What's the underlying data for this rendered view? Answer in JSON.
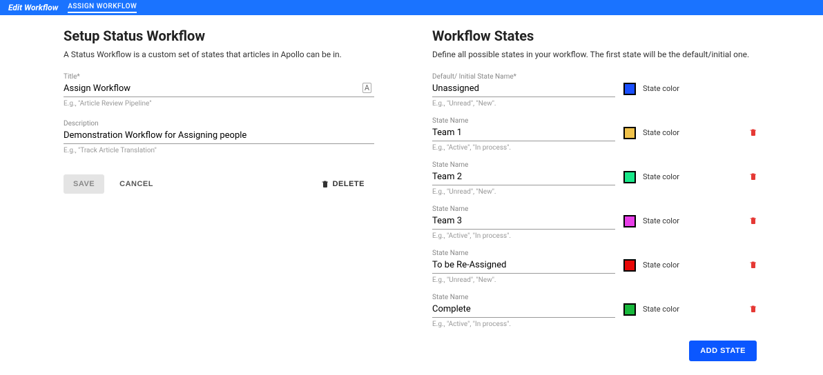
{
  "topbar": {
    "title": "Edit Workflow",
    "tab": "ASSIGN WORKFLOW"
  },
  "setup": {
    "heading": "Setup Status Workflow",
    "sub": "A Status Workflow is a custom set of states that articles in Apollo can be in.",
    "title_label": "Title*",
    "title_value": "Assign Workflow",
    "title_hint": "E.g., \"Article Review Pipeline\"",
    "desc_label": "Description",
    "desc_value": "Demonstration Workflow for Assigning people",
    "desc_hint": "E.g., \"Track Article Translation\"",
    "save": "Save",
    "cancel": "Cancel",
    "delete": "Delete"
  },
  "states": {
    "heading": "Workflow States",
    "sub": "Define all possible states in your workflow. The first state will be the default/initial one.",
    "initial_label": "Default/ Initial State Name*",
    "state_label": "State Name",
    "hint_a": "E.g., \"Unread\", \"New\".",
    "hint_b": "E.g., \"Active\", \"In process\".",
    "color_label": "State color",
    "add": "Add State",
    "items": [
      {
        "name": "Unassigned",
        "color": "#1a4fff",
        "deletable": false,
        "hint": "a"
      },
      {
        "name": "Team 1",
        "color": "#f0c24b",
        "deletable": true,
        "hint": "b"
      },
      {
        "name": "Team 2",
        "color": "#19e889",
        "deletable": true,
        "hint": "a"
      },
      {
        "name": "Team 3",
        "color": "#e83fe8",
        "deletable": true,
        "hint": "b"
      },
      {
        "name": "To be Re-Assigned",
        "color": "#e80808",
        "deletable": true,
        "hint": "a"
      },
      {
        "name": "Complete",
        "color": "#18b83c",
        "deletable": true,
        "hint": "b"
      }
    ]
  }
}
